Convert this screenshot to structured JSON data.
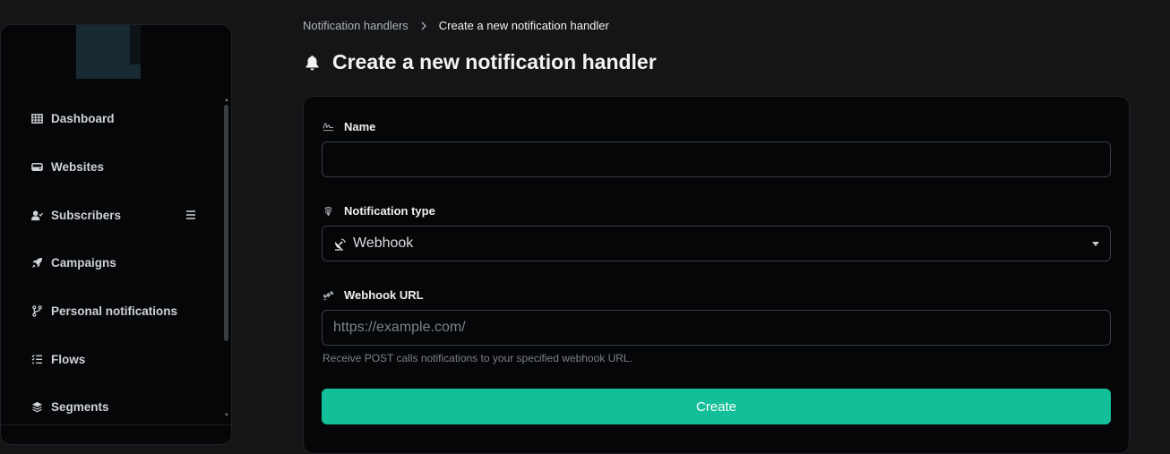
{
  "breadcrumb": {
    "parent": "Notification handlers",
    "current": "Create a new notification handler"
  },
  "page": {
    "title": "Create a new notification handler"
  },
  "sidebar": {
    "items": [
      {
        "label": "Dashboard",
        "icon": "grid-icon"
      },
      {
        "label": "Websites",
        "icon": "server-icon"
      },
      {
        "label": "Subscribers",
        "icon": "user-check-icon"
      },
      {
        "label": "Campaigns",
        "icon": "rocket-icon"
      },
      {
        "label": "Personal notifications",
        "icon": "code-branch-icon"
      },
      {
        "label": "Flows",
        "icon": "list-check-icon"
      },
      {
        "label": "Segments",
        "icon": "layers-icon"
      }
    ]
  },
  "form": {
    "name_label": "Name",
    "name_value": "",
    "type_label": "Notification type",
    "type_value": "Webhook",
    "url_label": "Webhook URL",
    "url_placeholder": "https://example.com/",
    "url_help": "Receive POST calls notifications to your specified webhook URL.",
    "submit_label": "Create"
  },
  "colors": {
    "accent": "#13bf98",
    "background": "#141517",
    "surface": "#050607"
  }
}
